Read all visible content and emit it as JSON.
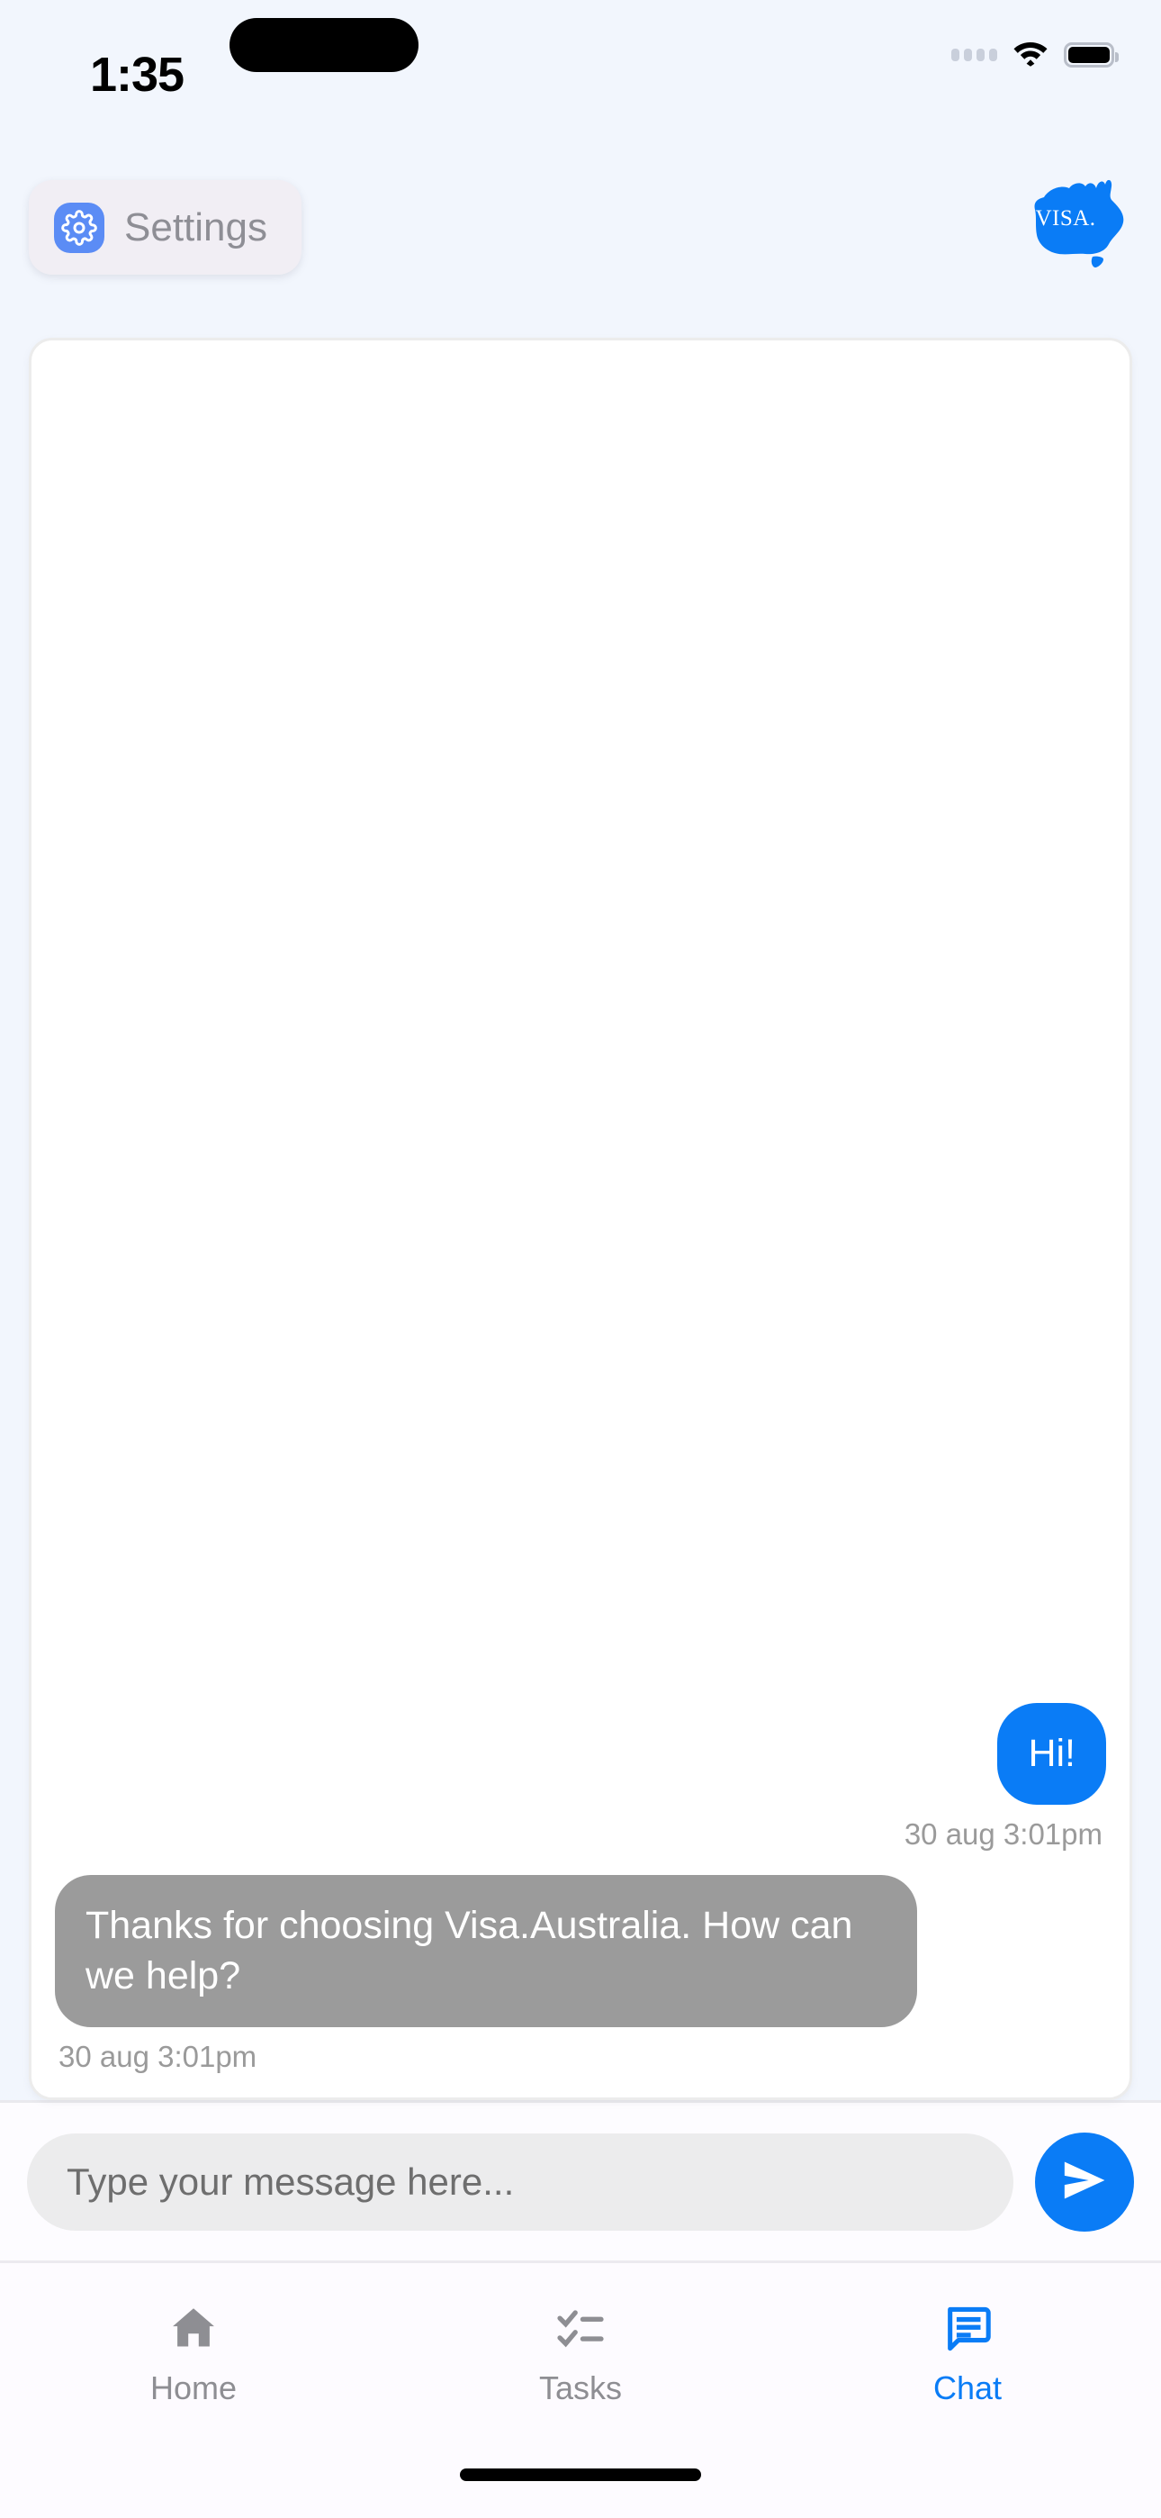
{
  "theme": {
    "page_bg": "#f2f6fd",
    "accent_blue": "#0a7cf6",
    "bot_bubble_gray": "#9b9b9b",
    "settings_pill_bg": "#f1eef4",
    "gear_badge_blue": "#5b8cf5",
    "muted_text": "#8e8e93"
  },
  "status_bar": {
    "time": "1:35",
    "cellular_icon": "cellular-dots-icon",
    "wifi_icon": "wifi-icon",
    "battery_icon": "battery-full-icon"
  },
  "top_bar": {
    "settings_label": "Settings",
    "settings_icon": "gear-icon",
    "brand_logo_icon": "australia-map-logo",
    "brand_logo_text": "VISA."
  },
  "chat": {
    "messages": [
      {
        "id": "msg-1",
        "author": "user",
        "text": "Hi!",
        "timestamp": "30 aug 3:01pm"
      },
      {
        "id": "msg-2",
        "author": "bot",
        "text": "Thanks for choosing Visa.Australia. How can we help?",
        "timestamp": "30 aug 3:01pm"
      }
    ]
  },
  "composer": {
    "placeholder": "Type your message here...",
    "value": "",
    "send_icon": "send-paper-plane-icon"
  },
  "bottom_nav": {
    "items": [
      {
        "label": "Home",
        "icon": "home-icon",
        "active": false
      },
      {
        "label": "Tasks",
        "icon": "checklist-icon",
        "active": false
      },
      {
        "label": "Chat",
        "icon": "chat-bubble-icon",
        "active": true
      }
    ]
  }
}
